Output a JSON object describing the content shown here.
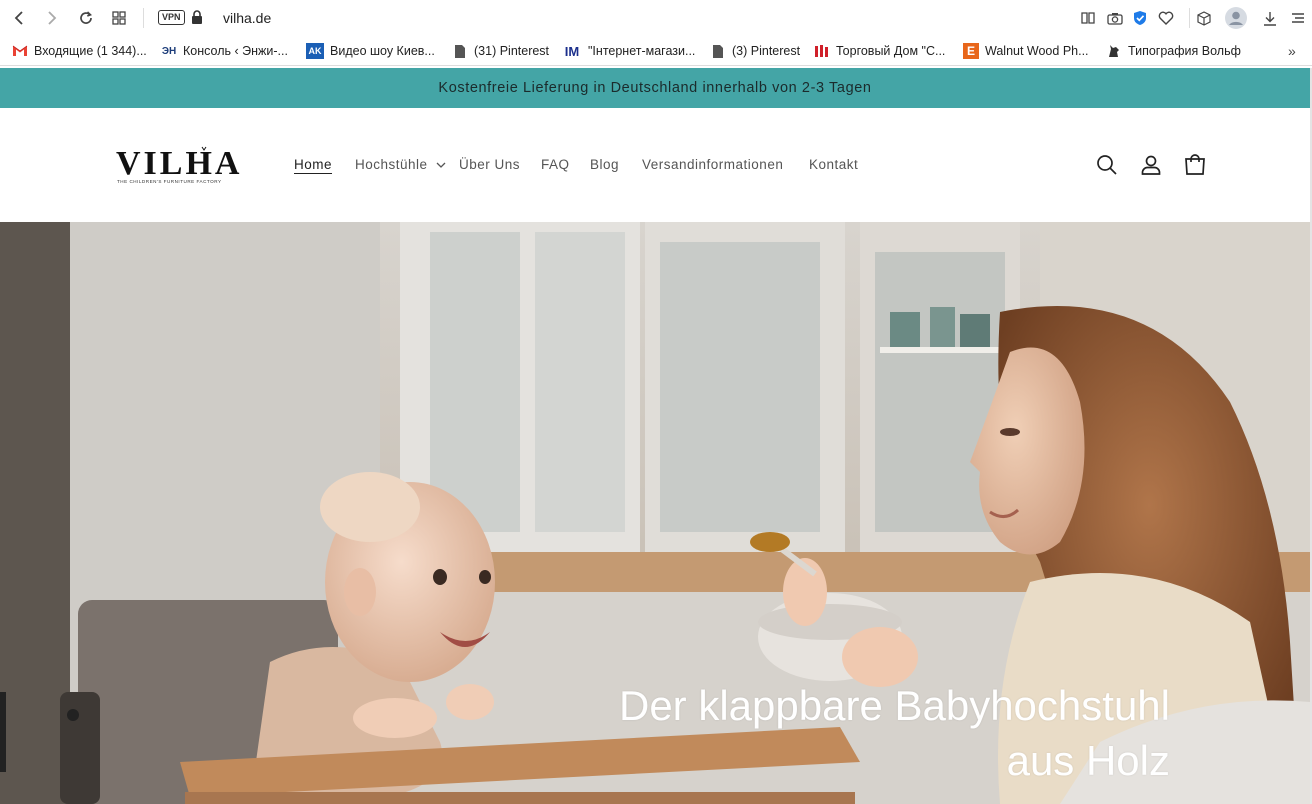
{
  "browser": {
    "vpn_label": "VPN",
    "url": "vilha.de",
    "bookmarks": [
      {
        "label": "Входящие (1 344)...",
        "icon": "gmail-icon"
      },
      {
        "label": "Консоль ‹ Энжи-...",
        "icon": "enji-icon"
      },
      {
        "label": "Видео шоу Киев...",
        "icon": "ak-icon"
      },
      {
        "label": "(31) Pinterest",
        "icon": "page-icon"
      },
      {
        "label": "\"Інтернет-магази...",
        "icon": "im-icon"
      },
      {
        "label": "(3) Pinterest",
        "icon": "page-icon"
      },
      {
        "label": "Торговый Дом \"С...",
        "icon": "td-icon"
      },
      {
        "label": "Walnut Wood Ph...",
        "icon": "etsy-icon"
      },
      {
        "label": "Типография Вольф",
        "icon": "wolf-icon"
      }
    ]
  },
  "announcement": "Kostenfreie Lieferung in Deutschland innerhalb von 2-3 Tagen",
  "logo": {
    "text": "VILHA",
    "tagline": "THE CHILDREN'S FURNITURE FACTORY"
  },
  "nav": {
    "home": "Home",
    "hochstuele": "Hochstühle",
    "ueber": "Über Uns",
    "faq": "FAQ",
    "blog": "Blog",
    "versand": "Versandinformationen",
    "kontakt": "Kontakt"
  },
  "hero": {
    "title_line1": "Der klappbare Babyhochstuhl",
    "title_line2": "aus Holz"
  },
  "colors": {
    "announce_bg": "#44a5a6"
  }
}
